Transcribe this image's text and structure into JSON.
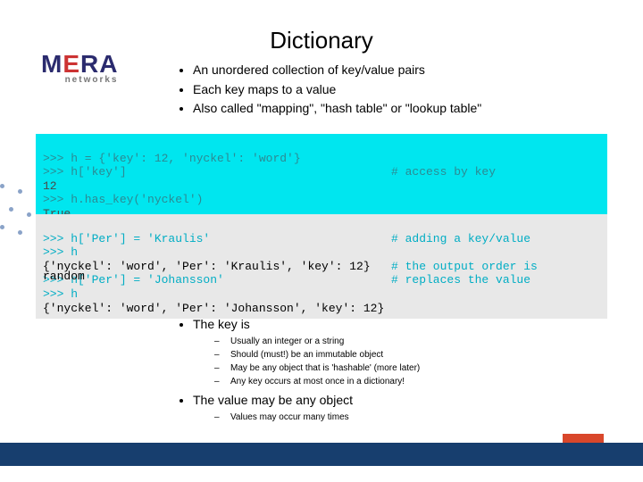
{
  "title": "Dictionary",
  "logo": {
    "text_main": "MERA",
    "text_sub": "networks"
  },
  "intro_bullets": [
    "An unordered collection of key/value pairs",
    "Each key maps to a value",
    "Also called \"mapping\", \"hash table\" or \"lookup table\""
  ],
  "code1": {
    "l1a": ">>> h = {'key': 12, 'nyckel': 'word'}",
    "l2a": ">>> h['key']",
    "l2b": "# access by key",
    "l3a": "12",
    "l4a": ">>> h.has_key('nyckel')",
    "l5a": "True"
  },
  "code2": {
    "l1a": ">>> h['Per'] = 'Kraulis'",
    "l1b": "# adding a key/value",
    "l2a": ">>> h",
    "l3a": "{'nyckel': 'word', 'Per': 'Kraulis', 'key': 12}",
    "l3b": "# the output order is",
    "l3over": "random",
    "l4a": ">>> h['Per'] = 'Johansson'",
    "l4b": "# replaces the value",
    "l5a": ">>> h",
    "l6a": "{'nyckel': 'word', 'Per': 'Johansson', 'key': 12}"
  },
  "key_heading": "The key is",
  "key_bullets": [
    "Usually an integer or a string",
    "Should (must!) be an immutable object",
    "May be any object that is 'hashable' (more later)",
    "Any key occurs at most once in a dictionary!"
  ],
  "value_heading": "The value may be any object",
  "value_bullets": [
    "Values may occur many times"
  ]
}
